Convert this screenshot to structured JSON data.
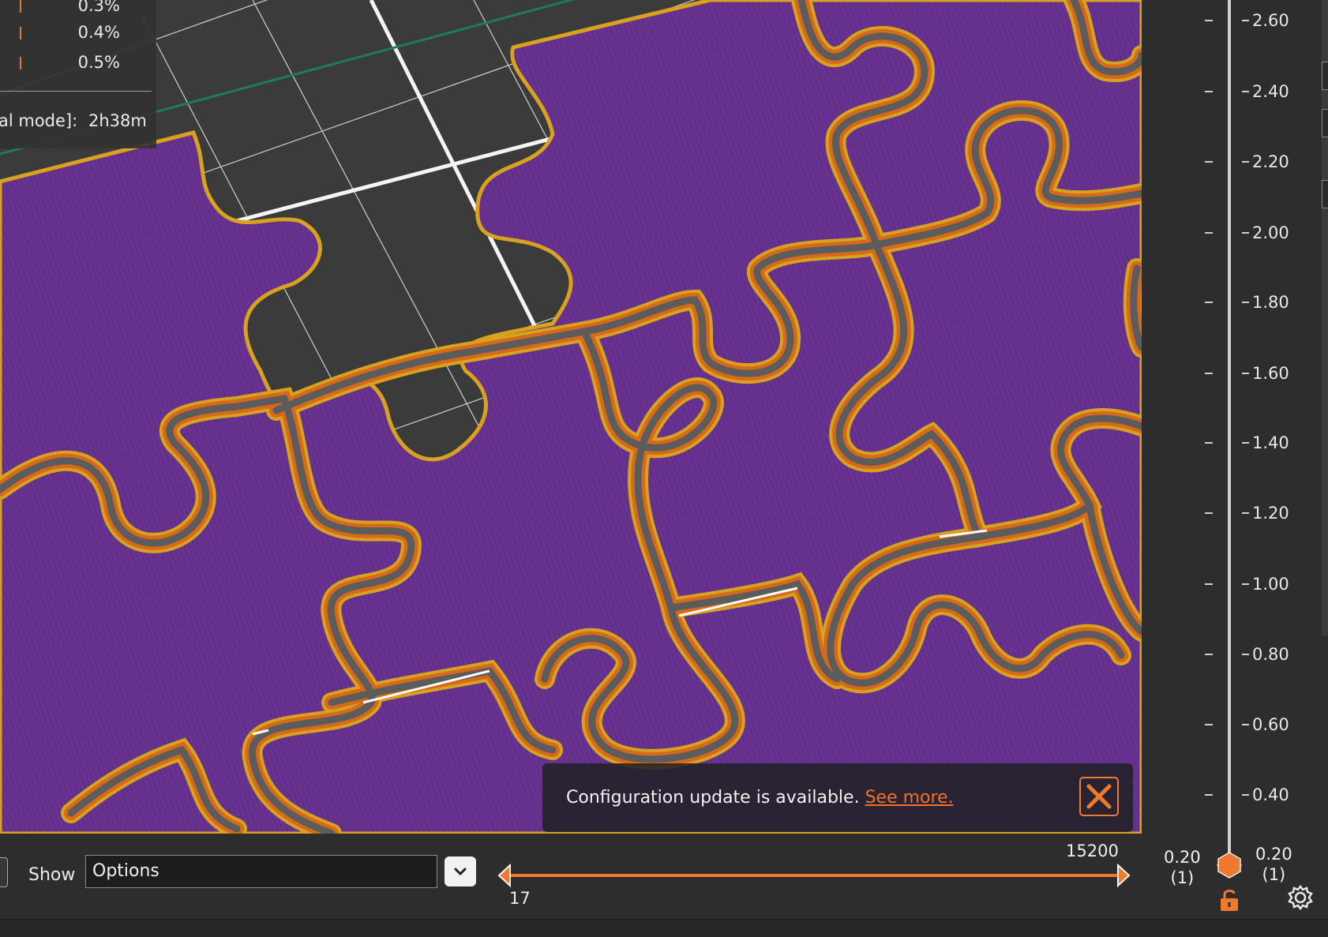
{
  "legend": {
    "values": [
      "0.3%",
      "0.4%",
      "0.5%"
    ],
    "time_label": "al mode]:",
    "time_value": "2h38m"
  },
  "notification": {
    "message": "Configuration update is available.",
    "link": "See more."
  },
  "bottom_bar": {
    "show_label": "Show",
    "show_value": "Options"
  },
  "horizontal_slider": {
    "min_label": "17",
    "max_label": "15200",
    "accent_color": "#ef7a2d"
  },
  "vertical_slider": {
    "ticks": [
      "2.60",
      "2.40",
      "2.20",
      "2.00",
      "1.80",
      "1.60",
      "1.40",
      "1.20",
      "1.00",
      "0.80",
      "0.60",
      "0.40"
    ],
    "lower": {
      "height": "0.20",
      "layer": "(1)"
    },
    "upper": {
      "height": "0.20",
      "layer": "(1)"
    }
  },
  "viewport": {
    "print_color": "#6a3592",
    "perimeter_colors": [
      "#d8a21e",
      "#d56a1a",
      "#5c5c5c"
    ],
    "bed_color": "#3d3d3d"
  },
  "icons": [
    "close-icon",
    "chevron-down-icon",
    "lock-icon",
    "settings-gear-icon",
    "slider-thumb-left-icon",
    "slider-thumb-right-icon",
    "layer-thumb-icon"
  ]
}
